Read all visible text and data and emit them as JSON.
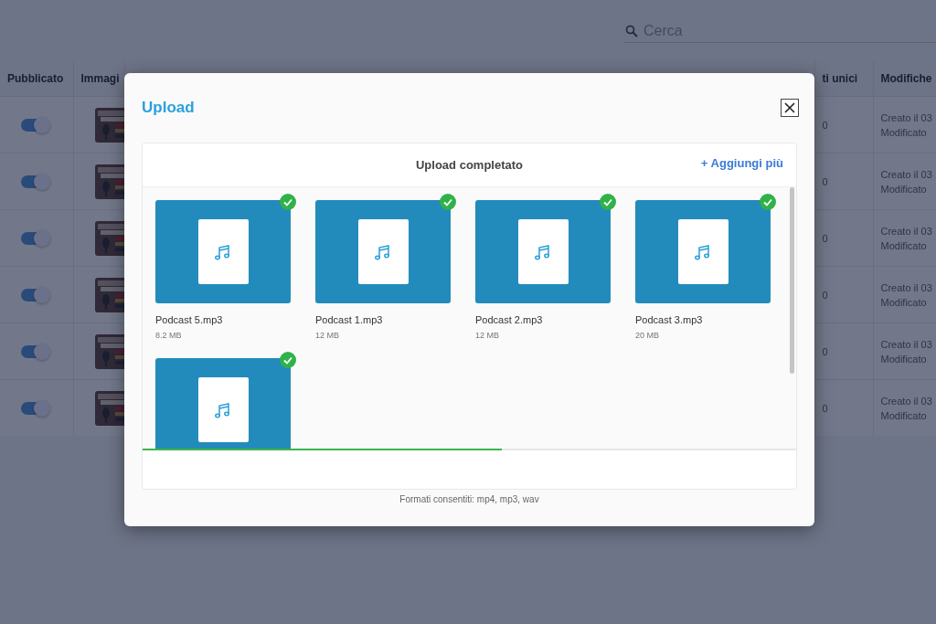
{
  "search": {
    "placeholder": "Cerca"
  },
  "table": {
    "columns": [
      "Pubblicato",
      "Immagi",
      "ti unici",
      "Modifiche"
    ],
    "rows": [
      {
        "published": true,
        "views": "0",
        "created": "Creato il 03",
        "modified": "Modificato"
      },
      {
        "published": true,
        "views": "0",
        "created": "Creato il 03",
        "modified": "Modificato"
      },
      {
        "published": true,
        "views": "0",
        "created": "Creato il 03",
        "modified": "Modificato"
      },
      {
        "published": true,
        "views": "0",
        "created": "Creato il 03",
        "modified": "Modificato"
      },
      {
        "published": true,
        "views": "0",
        "created": "Creato il 03",
        "modified": "Modificato"
      },
      {
        "published": true,
        "views": "0",
        "created": "Creato il 03",
        "modified": "Modificato"
      }
    ]
  },
  "dialog": {
    "title": "Upload",
    "status": "Upload completato",
    "add_more": "+ Aggiungi più",
    "files": [
      {
        "name": "Podcast 5.mp3",
        "size": "8.2 MB",
        "complete": true
      },
      {
        "name": "Podcast 1.mp3",
        "size": "12 MB",
        "complete": true
      },
      {
        "name": "Podcast 2.mp3",
        "size": "12 MB",
        "complete": true
      },
      {
        "name": "Podcast 3.mp3",
        "size": "20 MB",
        "complete": true
      },
      {
        "complete": true
      }
    ],
    "progress": {
      "level": 0.55
    },
    "note": "Formati consentiti: mp4, mp3, wav"
  }
}
